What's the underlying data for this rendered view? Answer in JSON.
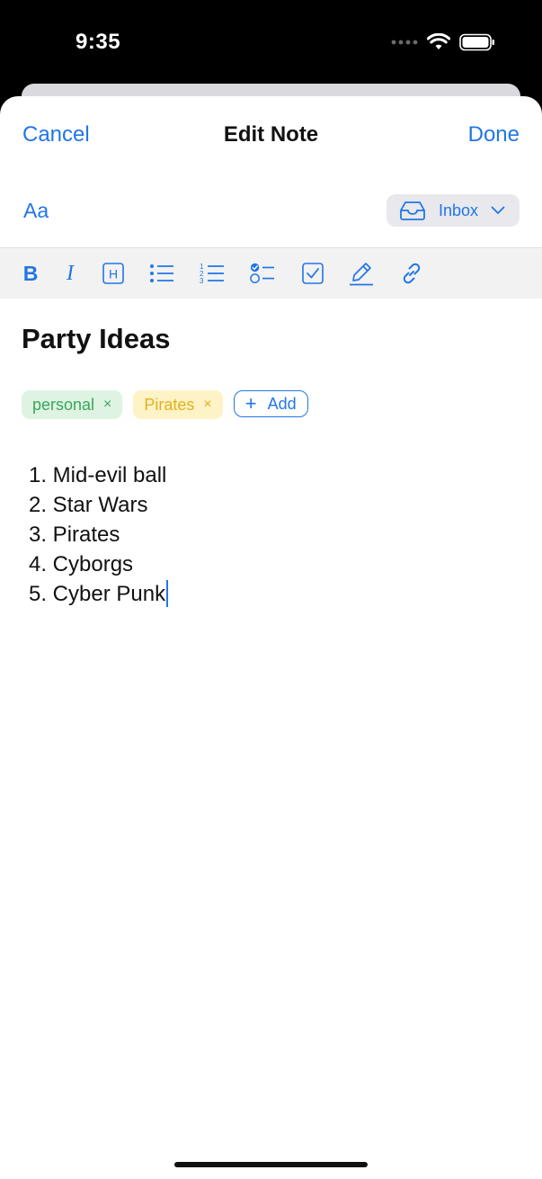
{
  "status_bar": {
    "time": "9:35"
  },
  "nav": {
    "cancel_label": "Cancel",
    "title": "Edit Note",
    "done_label": "Done"
  },
  "format_row": {
    "text_style_label": "Aa",
    "folder_label": "Inbox"
  },
  "toolbar": {
    "bold_label": "B",
    "italic_label": "I",
    "heading_label": "H"
  },
  "note": {
    "title": "Party Ideas",
    "tags": [
      {
        "label": "personal",
        "color": "#36a85a"
      },
      {
        "label": "Pirates",
        "color": "#e0b21b"
      }
    ],
    "add_tag_label": "Add",
    "items": [
      "1. Mid-evil ball",
      "2. Star Wars",
      "3. Pirates",
      "4. Cyborgs",
      "5. Cyber Punk"
    ]
  },
  "colors": {
    "accent": "#2176e6",
    "toolbar_bg": "#f2f2f3"
  },
  "icons": {
    "tag_remove": "×",
    "add": "+"
  }
}
